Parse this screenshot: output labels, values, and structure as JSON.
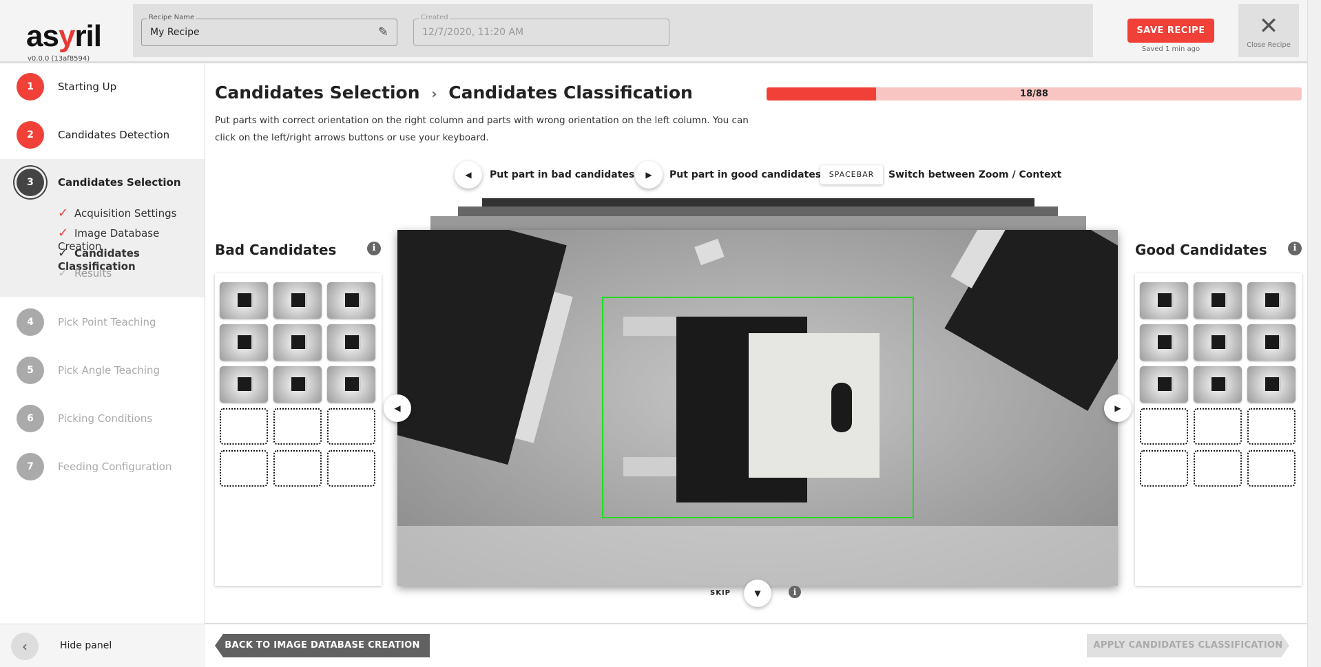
{
  "app": {
    "logo": "asyril",
    "version": "v0.0.0 (13af8594)"
  },
  "header": {
    "recipe_name_label": "Recipe Name",
    "recipe_name": "My Recipe",
    "created_label": "Created",
    "created": "12/7/2020, 11:20 AM",
    "save_label": "SAVE RECIPE",
    "saved_status": "Saved 1 min ago",
    "close_label": "Close Recipe"
  },
  "sidebar": {
    "steps": [
      {
        "num": "1",
        "label": "Starting Up",
        "state": "done"
      },
      {
        "num": "2",
        "label": "Candidates Detection",
        "state": "done"
      },
      {
        "num": "3",
        "label": "Candidates Selection",
        "state": "active"
      },
      {
        "num": "4",
        "label": "Pick Point Teaching",
        "state": "todo"
      },
      {
        "num": "5",
        "label": "Pick Angle Teaching",
        "state": "todo"
      },
      {
        "num": "6",
        "label": "Picking Conditions",
        "state": "todo"
      },
      {
        "num": "7",
        "label": "Feeding Configuration",
        "state": "todo"
      }
    ],
    "substeps": [
      {
        "label": "Acquisition Settings",
        "state": "done"
      },
      {
        "label": "Image Database Creation",
        "state": "done"
      },
      {
        "label": "Candidates Classification",
        "state": "current"
      },
      {
        "label": "Results",
        "state": "todo"
      }
    ],
    "hide_label": "Hide panel"
  },
  "main": {
    "breadcrumb_parent": "Candidates Selection",
    "breadcrumb_sep": "›",
    "title": "Candidates Classification",
    "progress": {
      "label": "18/88",
      "current": 18,
      "total": 88
    },
    "description": "Put parts with correct orientation on the right column and parts with wrong orientation on the left column. You can click on the left/right arrows buttons or use your keyboard.",
    "hints": {
      "bad": "Put part in bad candidates",
      "good": "Put part in good candidates",
      "key": "SPACEBAR",
      "switch": "Switch between Zoom / Context"
    },
    "bad_title": "Bad Candidates",
    "good_title": "Good Candidates",
    "bad_filled": 9,
    "good_filled": 9,
    "slots": 15,
    "skip_label": "SKIP",
    "back_label": "BACK TO IMAGE DATABASE CREATION",
    "apply_label": "APPLY CANDIDATES CLASSIFICATION"
  },
  "colors": {
    "accent": "#f04037",
    "progress_bg": "#f8c5c2",
    "selection_box": "#22dd22",
    "back_button": "#616161",
    "disabled_button": "#e0e0e0"
  }
}
